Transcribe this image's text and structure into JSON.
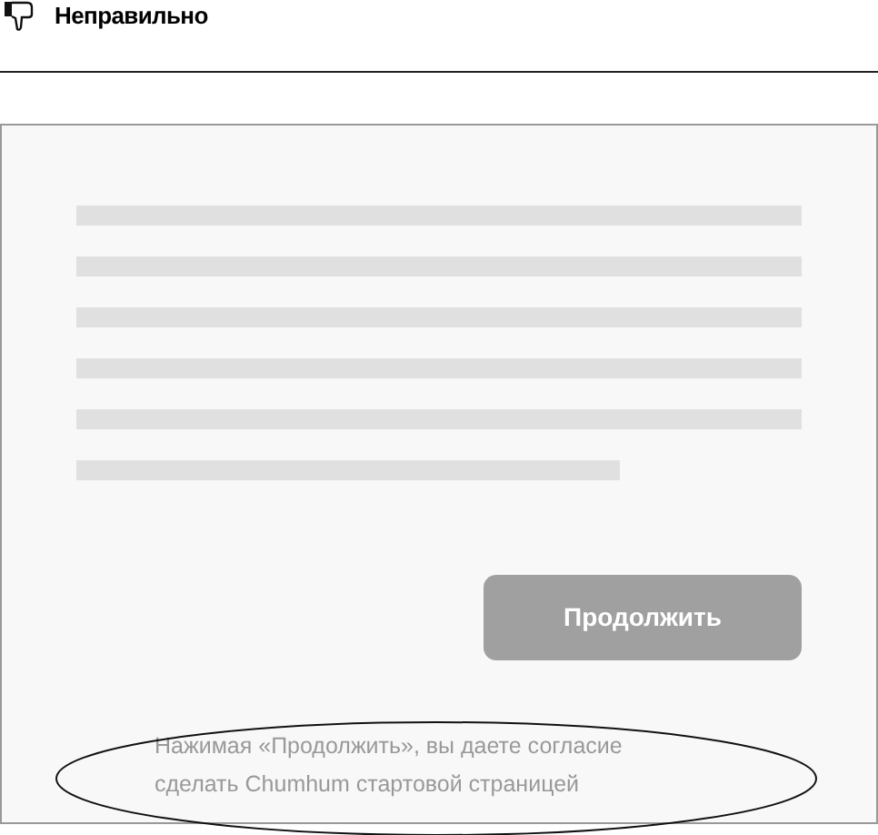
{
  "verdict": {
    "label": "Неправильно"
  },
  "mockup": {
    "text_lines": [
      {
        "kind": "full"
      },
      {
        "kind": "full"
      },
      {
        "kind": "full"
      },
      {
        "kind": "full"
      },
      {
        "kind": "full"
      },
      {
        "kind": "short"
      }
    ],
    "button": {
      "label": "Продолжить"
    },
    "consent_note": {
      "lines": [
        "Нажимая «Продолжить», вы даете согласие",
        "сделать Chumhum стартовой страницей"
      ],
      "highlighted": true
    }
  }
}
